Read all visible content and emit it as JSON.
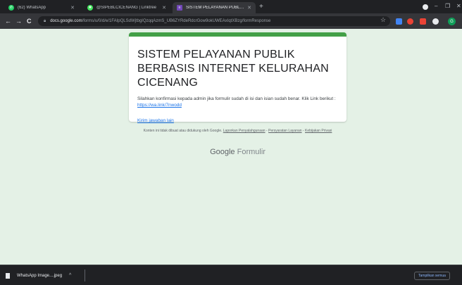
{
  "tabs": [
    {
      "title": "(62) WhatsApp",
      "icon": "whatsapp-icon",
      "color": "#25d366"
    },
    {
      "title": "@SIPEBLCICENANG | Linktree",
      "icon": "linktree-icon",
      "color": "#43e55e"
    },
    {
      "title": "SISTEM PELAYANAN PUBLIK BER",
      "icon": "google-forms-icon",
      "color": "#7248b9"
    }
  ],
  "new_tab_label": "+",
  "window": {
    "minimize": "–",
    "restore": "❐",
    "close": "✕"
  },
  "toolbar": {
    "back": "←",
    "forward": "→",
    "reload": "C",
    "url_host": "docs.google.com",
    "url_path": "/forms/u/0/d/e/1FAIpQLSdWjtbgIQzqqAzmS_UB6ZYRdeRdcrGow9okUWEAxIqtXBzg/formResponse",
    "star": "☆",
    "profile_initial": "G"
  },
  "extensions": [
    "#4285f4",
    "#ea4335",
    "#ea4335",
    "#e8eaed"
  ],
  "form": {
    "title": "SISTEM PELAYANAN PUBLIK BERBASIS INTERNET KELURAHAN CICENANG",
    "confirmation": "Silahkan konfirmasi kepada admin jika formulir sudah di isi dan isian  sudah benar. Klik Link berikut : ",
    "confirmation_link": "https://wa.link/7nwodd",
    "submit_another": "Kirim jawaban lain"
  },
  "footer": {
    "note": "Konten ini tidak dibuat atau didukung oleh Google. ",
    "report_abuse": "Laporkan Penyalahgunaan",
    "sep1": " - ",
    "terms": "Persyaratan Layanan",
    "sep2": " - ",
    "privacy": "Kebijakan Privasi",
    "brand_google": "Google",
    "brand_forms": " Formulir"
  },
  "downloads": {
    "file_name": "WhatsApp Image....jpeg",
    "chevron": "^",
    "show_all": "Tampilkan semua"
  }
}
